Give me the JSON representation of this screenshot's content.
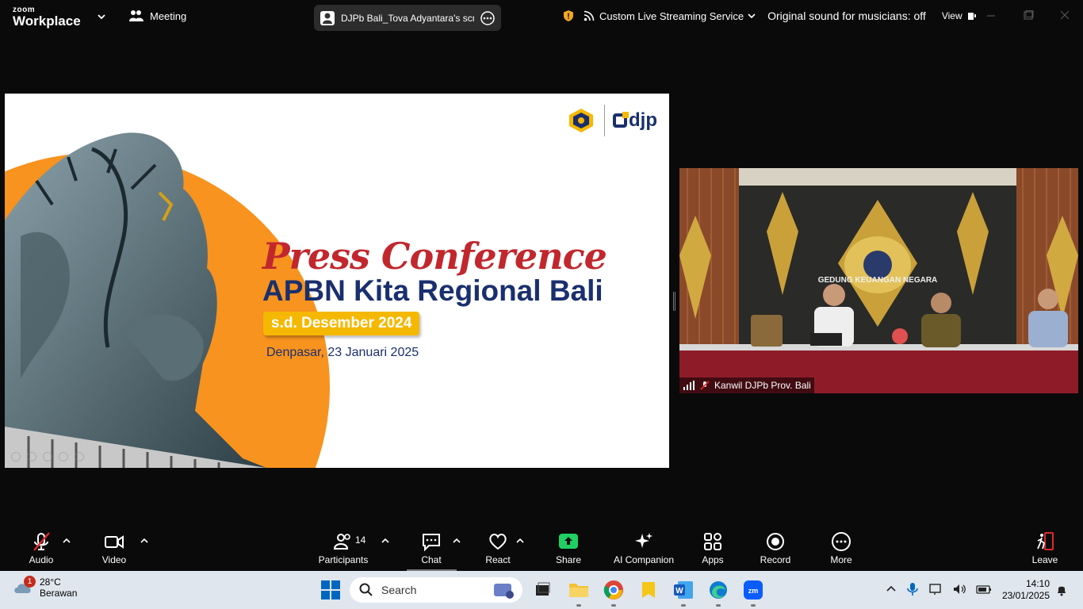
{
  "app": {
    "brand_small": "zoom",
    "brand_big": "Workplace",
    "meeting_label": "Meeting"
  },
  "share_pill": {
    "text": "DJPb Bali_Tova Adyantara's scree"
  },
  "top_right": {
    "streaming_label": "Custom Live Streaming Service",
    "sound_label": "Original sound for musicians: off",
    "view_label": "View"
  },
  "slide": {
    "title_script": "Press Conference",
    "title_main": "APBN Kita Regional Bali",
    "periode": "s.d. Desember 2024",
    "lokasi_tanggal": "Denpasar, 23 Januari 2025",
    "logo_text": "djp"
  },
  "video": {
    "participant_name": "Kanwil DJPb Prov. Bali",
    "banner_text": "GEDUNG KEUANGAN NEGARA"
  },
  "toolbar": {
    "audio": "Audio",
    "video": "Video",
    "participants": "Participants",
    "participants_count": "14",
    "chat": "Chat",
    "react": "React",
    "share": "Share",
    "ai": "AI Companion",
    "apps": "Apps",
    "record": "Record",
    "more": "More",
    "leave": "Leave"
  },
  "taskbar": {
    "weather_temp": "28°C",
    "weather_desc": "Berawan",
    "notif_count": "1",
    "search_placeholder": "Search",
    "time": "14:10",
    "date": "23/01/2025"
  },
  "colors": {
    "accent_green": "#1fd162",
    "slide_navy": "#1a2f6e",
    "slide_red": "#c1272d",
    "slide_orange": "#f7931e",
    "slide_yellow": "#f5b800",
    "leave_red": "#e02828"
  }
}
